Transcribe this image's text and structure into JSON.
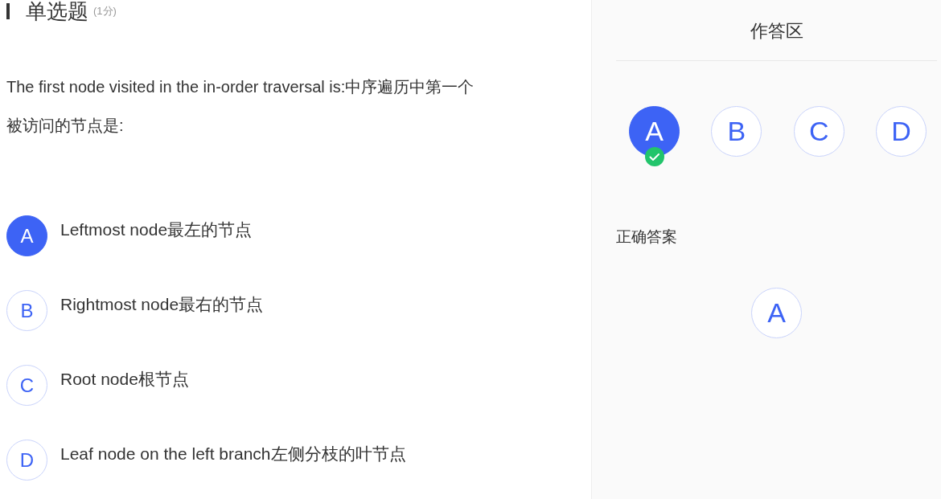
{
  "question": {
    "type_label": "单选题",
    "score": "(1分)",
    "text": "The first node visited in the in-order traversal is:中序遍历中第一个被访问的节点是:"
  },
  "options": [
    {
      "letter": "A",
      "text": "Leftmost node最左的节点",
      "selected": true
    },
    {
      "letter": "B",
      "text": "Rightmost node最右的节点",
      "selected": false
    },
    {
      "letter": "C",
      "text": "Root node根节点",
      "selected": false
    },
    {
      "letter": "D",
      "text": "Leaf node on the left branch左侧分枝的叶节点",
      "selected": false
    }
  ],
  "answer_area": {
    "title": "作答区",
    "choices": [
      {
        "letter": "A",
        "selected": true
      },
      {
        "letter": "B",
        "selected": false
      },
      {
        "letter": "C",
        "selected": false
      },
      {
        "letter": "D",
        "selected": false
      }
    ]
  },
  "correct_answer": {
    "label": "正确答案",
    "letters": [
      "A"
    ]
  }
}
